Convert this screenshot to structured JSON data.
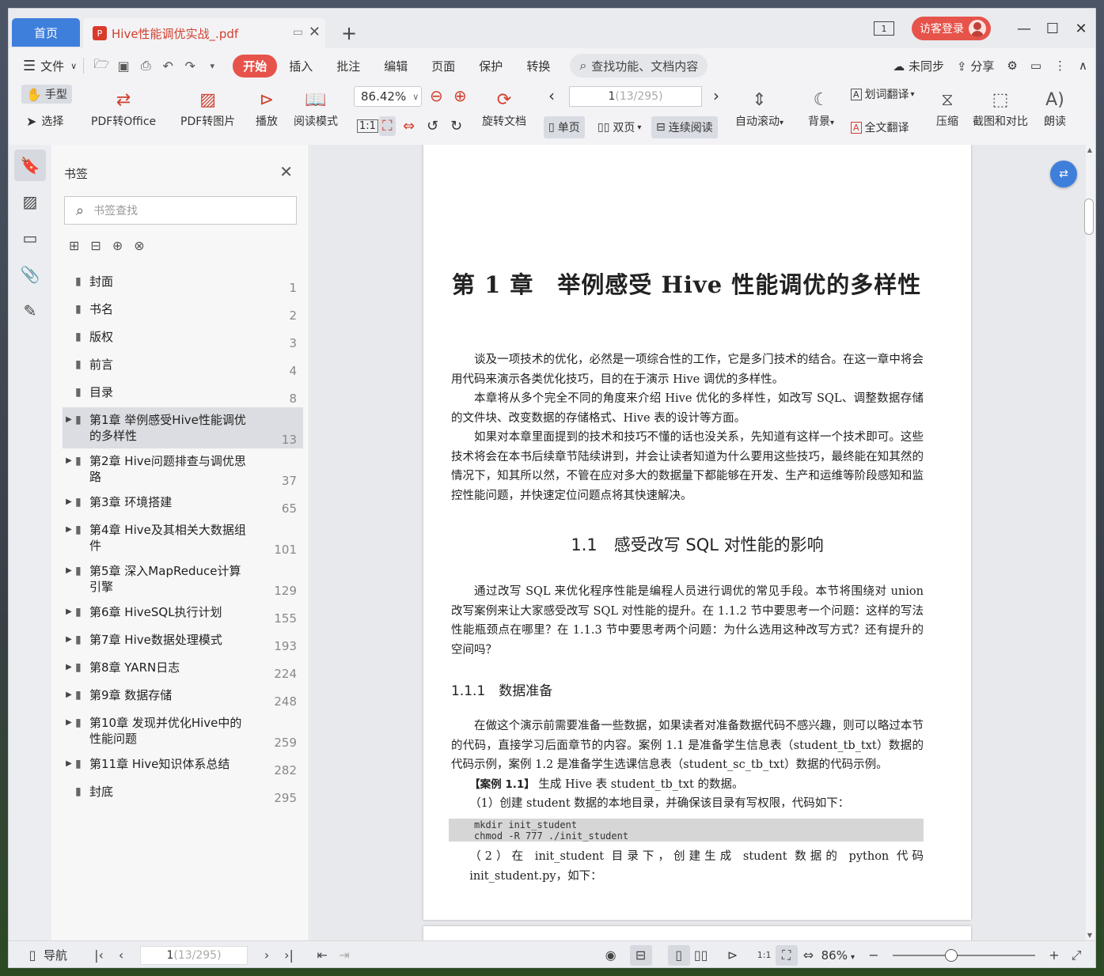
{
  "titlebar": {
    "home_tab": "首页",
    "doc_tab": "Hive性能调优实战_.pdf",
    "pdf_badge": "P",
    "window_count": "1",
    "login": "访客登录"
  },
  "menubar": {
    "file": "文件",
    "items": [
      "开始",
      "插入",
      "批注",
      "编辑",
      "页面",
      "保护",
      "转换"
    ],
    "search_placeholder": "查找功能、文档内容",
    "sync": "未同步",
    "share": "分享"
  },
  "ribbon": {
    "hand": "手型",
    "select": "选择",
    "pdf_to_office": "PDF转Office",
    "pdf_to_image": "PDF转图片",
    "play": "播放",
    "read_mode": "阅读模式",
    "zoom": "86.42%",
    "rotate": "旋转文档",
    "page_current": "1",
    "page_total": " (13/295)",
    "single": "单页",
    "double": "双页",
    "continuous": "连续阅读",
    "auto_scroll": "自动滚动",
    "background": "背景",
    "word_translate": "划词翻译",
    "full_translate": "全文翻译",
    "compress": "压缩",
    "screenshot_compare": "截图和对比",
    "read_aloud": "朗读"
  },
  "panel": {
    "title": "书签",
    "search_placeholder": "书签查找",
    "bookmarks": [
      {
        "label": "封面",
        "page": "1",
        "expandable": false
      },
      {
        "label": "书名",
        "page": "2",
        "expandable": false
      },
      {
        "label": "版权",
        "page": "3",
        "expandable": false
      },
      {
        "label": "前言",
        "page": "4",
        "expandable": false
      },
      {
        "label": "目录",
        "page": "8",
        "expandable": false
      },
      {
        "label": "第1章 举例感受Hive性能调优的多样性",
        "page": "13",
        "expandable": true,
        "selected": true
      },
      {
        "label": "第2章 Hive问题排查与调优思路",
        "page": "37",
        "expandable": true
      },
      {
        "label": "第3章 环境搭建",
        "page": "65",
        "expandable": true
      },
      {
        "label": "第4章 Hive及其相关大数据组件",
        "page": "101",
        "expandable": true
      },
      {
        "label": "第5章 深入MapReduce计算引擎",
        "page": "129",
        "expandable": true
      },
      {
        "label": "第6章 HiveSQL执行计划",
        "page": "155",
        "expandable": true
      },
      {
        "label": "第7章 Hive数据处理模式",
        "page": "193",
        "expandable": true
      },
      {
        "label": "第8章 YARN日志",
        "page": "224",
        "expandable": true
      },
      {
        "label": "第9章 数据存储",
        "page": "248",
        "expandable": true
      },
      {
        "label": "第10章 发现并优化Hive中的性能问题",
        "page": "259",
        "expandable": true
      },
      {
        "label": "第11章 Hive知识体系总结",
        "page": "282",
        "expandable": true
      },
      {
        "label": "封底",
        "page": "295",
        "expandable": false
      }
    ]
  },
  "document": {
    "chapter_title": "第 1 章　举例感受 Hive 性能调优的多样性",
    "intro": [
      "谈及一项技术的优化，必然是一项综合性的工作，它是多门技术的结合。在这一章中将会用代码来演示各类优化技巧，目的在于演示 Hive 调优的多样性。",
      "本章将从多个完全不同的角度来介绍 Hive 优化的多样性，如改写 SQL、调整数据存储的文件块、改变数据的存储格式、Hive 表的设计等方面。",
      "如果对本章里面提到的技术和技巧不懂的话也没关系，先知道有这样一个技术即可。这些技术将会在本书后续章节陆续讲到，并会让读者知道为什么要用这些技巧，最终能在知其然的情况下，知其所以然，不管在应对多大的数据量下都能够在开发、生产和运维等阶段感知和监控性能问题，并快速定位问题点将其快速解决。"
    ],
    "section_title": "1.1　感受改写 SQL 对性能的影响",
    "section_para": "通过改写 SQL 来优化程序性能是编程人员进行调优的常见手段。本节将围绕对 union 改写案例来让大家感受改写 SQL 对性能的提升。在 1.1.2 节中要思考一个问题：这样的写法性能瓶颈点在哪里？在 1.1.3 节中要思考两个问题：为什么选用这种改写方式？还有提升的空间吗？",
    "subsection_title": "1.1.1　数据准备",
    "subsection_para": "在做这个演示前需要准备一些数据，如果读者对准备数据代码不感兴趣，则可以略过本节的代码，直接学习后面章节的内容。案例 1.1 是准备学生信息表（student_tb_txt）数据的代码示例，案例 1.2 是准备学生选课信息表（student_sc_tb_txt）数据的代码示例。",
    "case_label": "【案例 1.1】",
    "case_text": " 生成 Hive 表 student_tb_txt 的数据。",
    "step1": "（1）创建 student 数据的本地目录，并确保该目录有写权限，代码如下：",
    "code_line1": "mkdir init_student",
    "code_line2": "chmod -R 777 ./init_student",
    "step2": "（2）在 init_student 目录下，创建生成 student 数据的 python 代码 init_student.py，如下："
  },
  "statusbar": {
    "nav": "导航",
    "page_current": "1",
    "page_total": " (13/295)",
    "zoom": "86%"
  }
}
